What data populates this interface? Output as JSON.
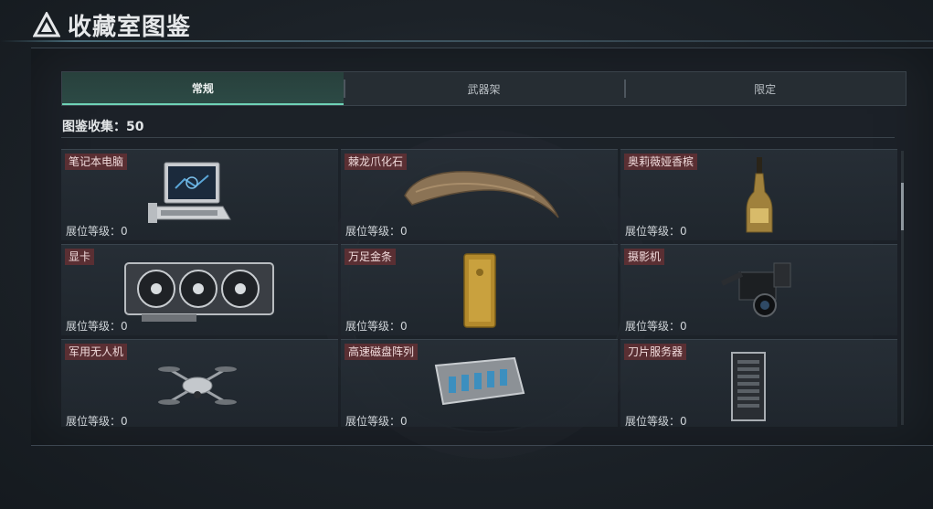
{
  "window": {
    "title": "收藏室图鉴"
  },
  "tabs": [
    {
      "label": "常规",
      "active": true
    },
    {
      "label": "武器架",
      "active": false
    },
    {
      "label": "限定",
      "active": false
    }
  ],
  "collection": {
    "label": "图鉴收集：50"
  },
  "colors": {
    "accent": "#6fd2b6",
    "name_tag": "#5a2f33"
  },
  "items": [
    {
      "name": "笔记本电脑",
      "level": "展位等级：0",
      "icon": "laptop-icon"
    },
    {
      "name": "棘龙爪化石",
      "level": "展位等级：0",
      "icon": "claw-fossil-icon"
    },
    {
      "name": "奥莉薇娅香槟",
      "level": "展位等级：0",
      "icon": "champagne-icon"
    },
    {
      "name": "显卡",
      "level": "展位等级：0",
      "icon": "graphics-card-icon"
    },
    {
      "name": "万足金条",
      "level": "展位等级：0",
      "icon": "gold-bar-icon"
    },
    {
      "name": "摄影机",
      "level": "展位等级：0",
      "icon": "camera-icon"
    },
    {
      "name": "军用无人机",
      "level": "展位等级：0",
      "icon": "drone-icon"
    },
    {
      "name": "高速磁盘阵列",
      "level": "展位等级：0",
      "icon": "disk-array-icon"
    },
    {
      "name": "刀片服务器",
      "level": "展位等级：0",
      "icon": "blade-server-icon"
    }
  ]
}
